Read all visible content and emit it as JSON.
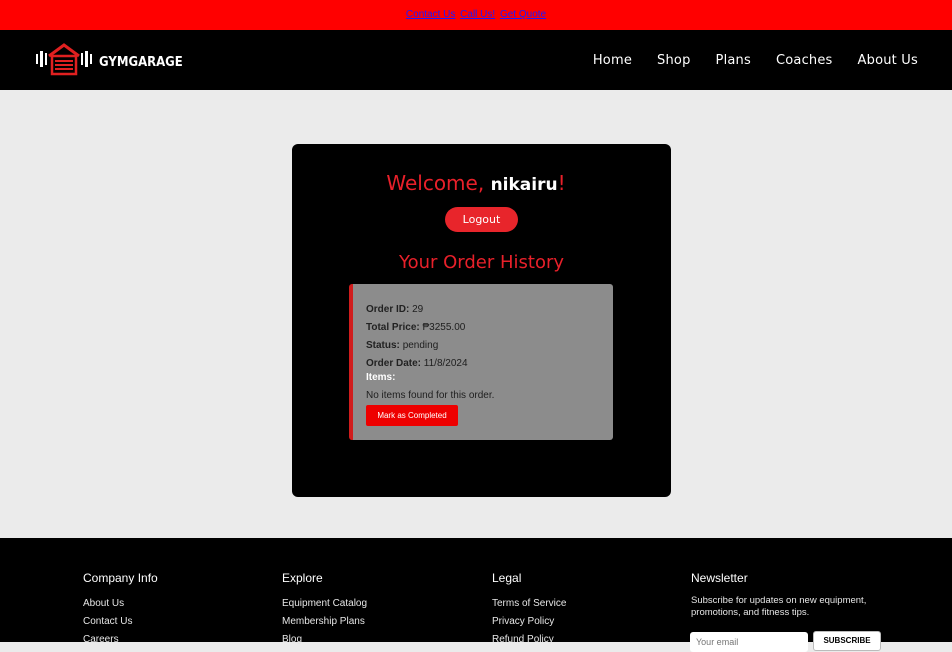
{
  "topbar": {
    "links": [
      "Contact Us",
      "Call Us!",
      "Get Quote"
    ]
  },
  "nav": {
    "logo_text": "GYMGARAGE",
    "links": [
      "Home",
      "Shop",
      "Plans",
      "Coaches",
      "About Us"
    ]
  },
  "account": {
    "welcome_prefix": "Welcome, ",
    "username": "nikairu",
    "welcome_suffix": "!",
    "logout_label": "Logout",
    "history_title": "Your Order History"
  },
  "order": {
    "id_label": "Order ID:",
    "id_value": "29",
    "price_label": "Total Price:",
    "price_value": "₱3255.00",
    "status_label": "Status:",
    "status_value": "pending",
    "date_label": "Order Date:",
    "date_value": "11/8/2024",
    "items_label": "Items:",
    "no_items": "No items found for this order.",
    "complete_button": "Mark as Completed"
  },
  "footer": {
    "company": {
      "heading": "Company Info",
      "links": [
        "About Us",
        "Contact Us",
        "Careers"
      ]
    },
    "explore": {
      "heading": "Explore",
      "links": [
        "Equipment Catalog",
        "Membership Plans",
        "Blog"
      ]
    },
    "legal": {
      "heading": "Legal",
      "links": [
        "Terms of Service",
        "Privacy Policy",
        "Refund Policy"
      ]
    },
    "newsletter": {
      "heading": "Newsletter",
      "text": "Subscribe for updates on new equipment, promotions, and fitness tips.",
      "input_placeholder": "Your email",
      "button": "SUBSCRIBE"
    }
  },
  "colors": {
    "accent_red": "#e8202a",
    "topbar_red": "#ff0000",
    "card_black": "#000000",
    "order_gray": "#8c8c8c"
  }
}
